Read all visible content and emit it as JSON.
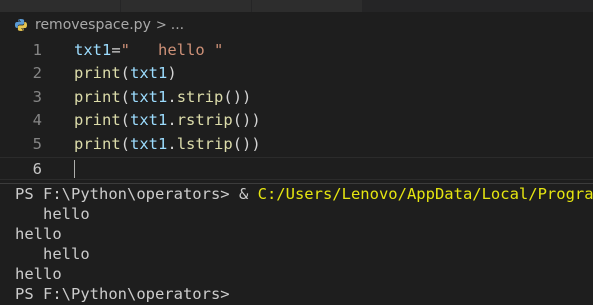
{
  "breadcrumb": {
    "file_icon": "python-icon",
    "file_name": "removespace.py",
    "separator": ">",
    "more": "..."
  },
  "editor": {
    "lines": [
      {
        "number": "1",
        "tokens": [
          [
            "var",
            "txt1"
          ],
          [
            "op",
            "="
          ],
          [
            "str",
            "\"   hello \""
          ]
        ]
      },
      {
        "number": "2",
        "tokens": [
          [
            "fn",
            "print"
          ],
          [
            "pun",
            "("
          ],
          [
            "var",
            "txt1"
          ],
          [
            "pun",
            ")"
          ]
        ]
      },
      {
        "number": "3",
        "tokens": [
          [
            "fn",
            "print"
          ],
          [
            "pun",
            "("
          ],
          [
            "var",
            "txt1"
          ],
          [
            "pun",
            "."
          ],
          [
            "fn",
            "strip"
          ],
          [
            "pun",
            "())"
          ]
        ]
      },
      {
        "number": "4",
        "tokens": [
          [
            "fn",
            "print"
          ],
          [
            "pun",
            "("
          ],
          [
            "var",
            "txt1"
          ],
          [
            "pun",
            "."
          ],
          [
            "fn",
            "rstrip"
          ],
          [
            "pun",
            "())"
          ]
        ]
      },
      {
        "number": "5",
        "tokens": [
          [
            "fn",
            "print"
          ],
          [
            "pun",
            "("
          ],
          [
            "var",
            "txt1"
          ],
          [
            "pun",
            "."
          ],
          [
            "fn",
            "lstrip"
          ],
          [
            "pun",
            "())"
          ]
        ]
      },
      {
        "number": "6",
        "tokens": []
      }
    ],
    "current_line": "6"
  },
  "terminal": {
    "prompt1": "PS F:\\Python\\operators> ",
    "amp": "& ",
    "command": "C:/Users/Lenovo/AppData/Local/Programs/",
    "output": [
      "   hello",
      "hello",
      "   hello",
      "hello"
    ],
    "prompt2": "PS F:\\Python\\operators>"
  },
  "colors": {
    "background": "#1e1e1e",
    "function": "#dcdcaa",
    "variable": "#9cdcfe",
    "string": "#ce9178",
    "command": "#e5e510"
  }
}
